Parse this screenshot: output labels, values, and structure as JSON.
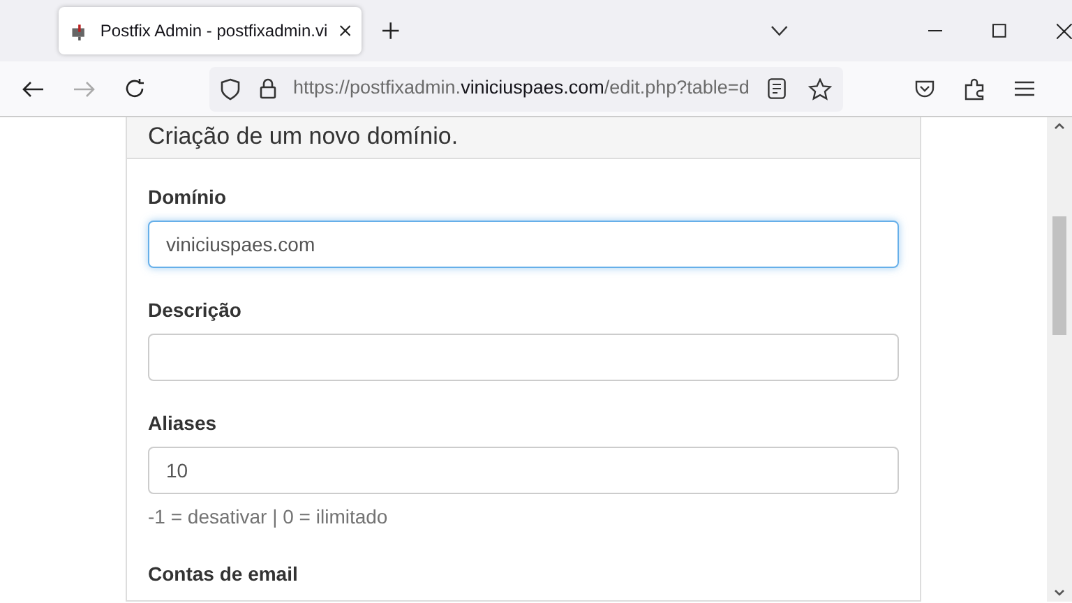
{
  "browser": {
    "tab_title": "Postfix Admin - postfixadmin.vi",
    "url": [
      {
        "kind": "dim",
        "text": "https://postfixadmin."
      },
      {
        "kind": "main",
        "text": "viniciuspaes.com"
      },
      {
        "kind": "dim",
        "text": "/edit.php?table=d"
      }
    ]
  },
  "panel": {
    "title": "Criação de um novo domínio.",
    "fields": [
      {
        "label": "Domínio",
        "value": "viniciuspaes.com",
        "focused": true
      },
      {
        "label": "Descrição",
        "focused": false
      },
      {
        "label": "Aliases",
        "value": "10",
        "focused": false,
        "help": "-1 = desativar | 0 = ilimitado"
      }
    ],
    "next_label": "Contas de email"
  }
}
